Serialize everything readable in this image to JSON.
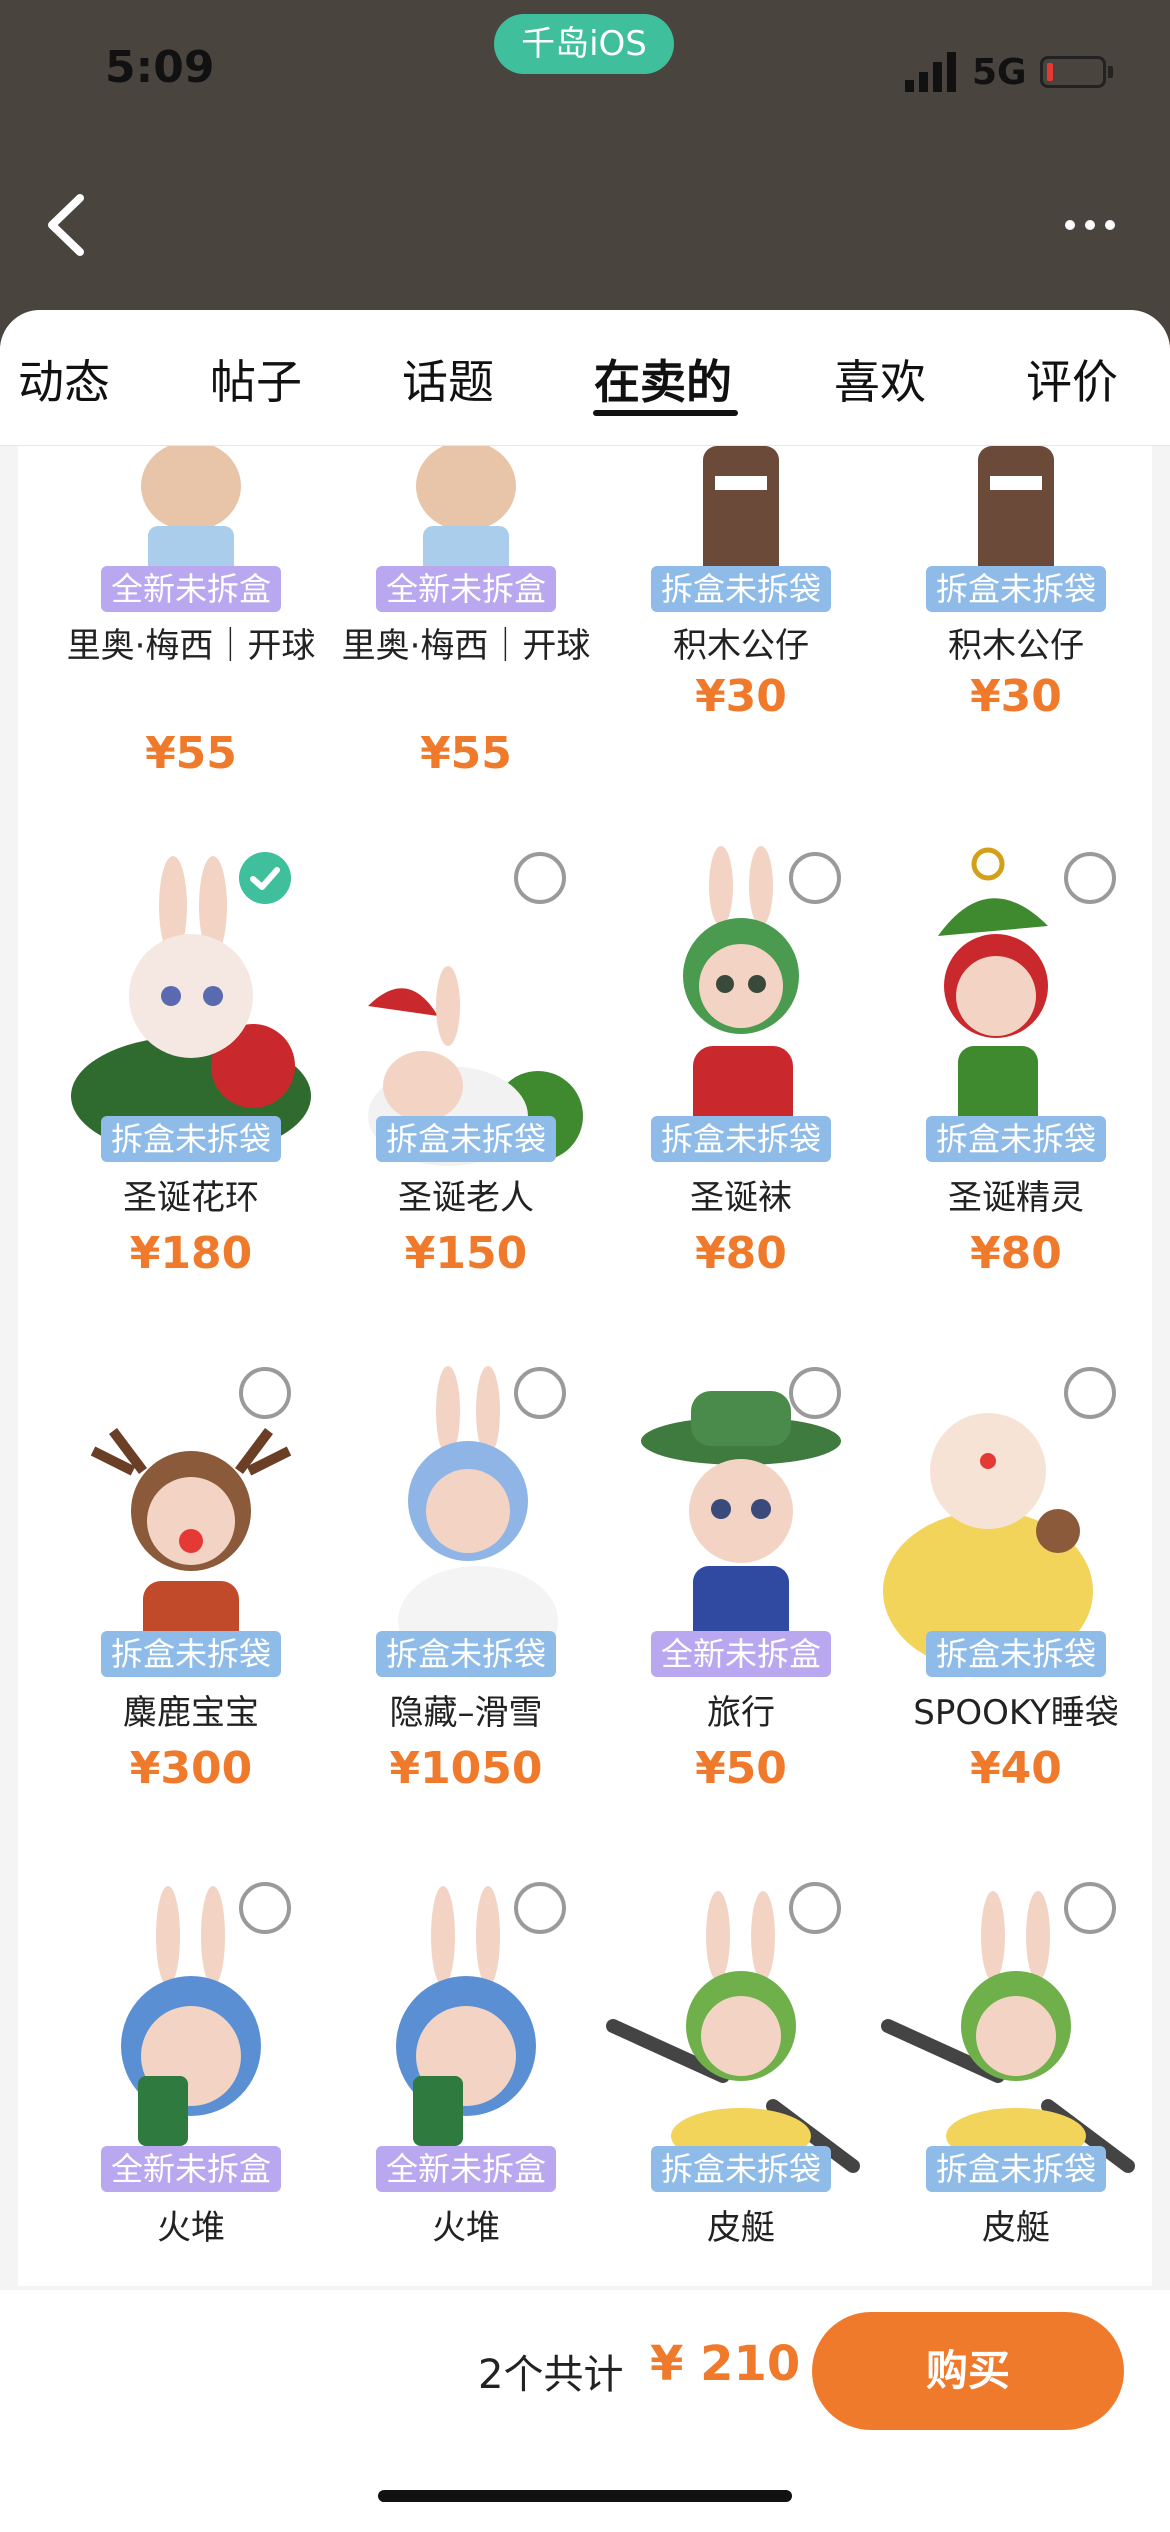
{
  "status": {
    "time": "5:09",
    "app_badge": "千岛iOS",
    "network": "5G"
  },
  "header": {
    "back_icon": "chevron-left-icon",
    "more_icon": "ellipsis-icon"
  },
  "tabs": [
    {
      "label": "动态"
    },
    {
      "label": "帖子"
    },
    {
      "label": "话题"
    },
    {
      "label": "在卖的",
      "active": true
    },
    {
      "label": "喜欢"
    },
    {
      "label": "评价"
    }
  ],
  "products": [
    {
      "tag": "全新未拆盒",
      "name": "里奥·梅西｜开球",
      "price": "¥55"
    },
    {
      "tag": "全新未拆盒",
      "name": "里奥·梅西｜开球",
      "price": "¥55"
    },
    {
      "tag": "拆盒未拆袋",
      "name": "积木公仔",
      "price": "¥30"
    },
    {
      "tag": "拆盒未拆袋",
      "name": "积木公仔",
      "price": "¥30"
    },
    {
      "tag": "拆盒未拆袋",
      "name": "圣诞花环",
      "price": "¥180",
      "checked": true
    },
    {
      "tag": "拆盒未拆袋",
      "name": "圣诞老人",
      "price": "¥150"
    },
    {
      "tag": "拆盒未拆袋",
      "name": "圣诞袜",
      "price": "¥80"
    },
    {
      "tag": "拆盒未拆袋",
      "name": "圣诞精灵",
      "price": "¥80"
    },
    {
      "tag": "拆盒未拆袋",
      "name": "麋鹿宝宝",
      "price": "¥300"
    },
    {
      "tag": "拆盒未拆袋",
      "name": "隐藏–滑雪",
      "price": "¥1050"
    },
    {
      "tag": "全新未拆盒",
      "name": "旅行",
      "price": "¥50"
    },
    {
      "tag": "拆盒未拆袋",
      "name": "SPOOKY睡袋",
      "price": "¥40"
    },
    {
      "tag": "全新未拆盒",
      "name": "火堆",
      "price": ""
    },
    {
      "tag": "全新未拆盒",
      "name": "火堆",
      "price": ""
    },
    {
      "tag": "拆盒未拆袋",
      "name": "皮艇",
      "price": ""
    },
    {
      "tag": "拆盒未拆袋",
      "name": "皮艇",
      "price": ""
    }
  ],
  "footer": {
    "total_label": "2个共计",
    "total_value": "¥ 210",
    "buy_label": "购买"
  },
  "colors": {
    "accent": "#f07a2c",
    "check": "#3fbf9c",
    "tag_new": "#b9a7f0",
    "tag_open": "#8ebbe8"
  }
}
